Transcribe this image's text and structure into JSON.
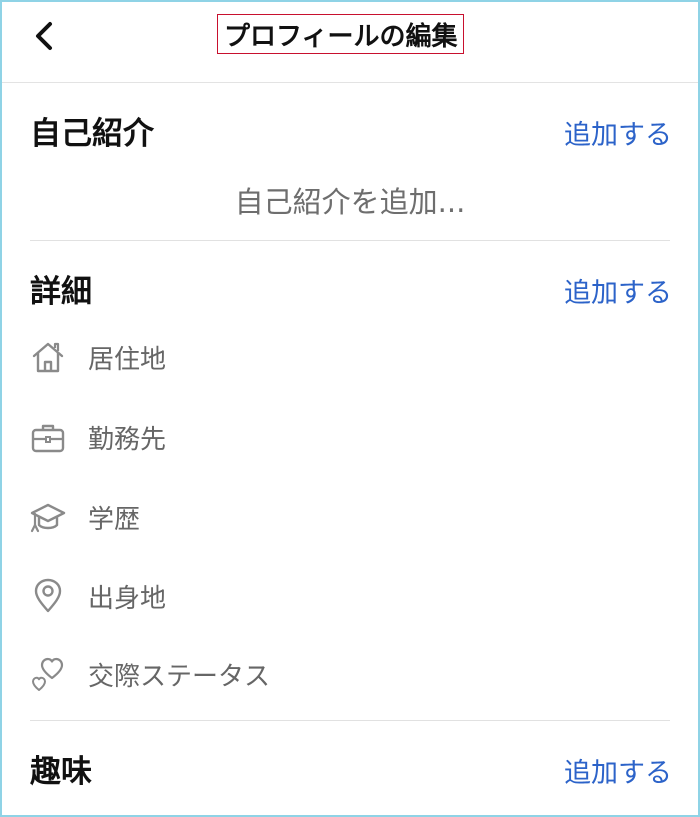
{
  "header": {
    "title": "プロフィールの編集",
    "back_icon": "chevron-left-icon"
  },
  "bio": {
    "title": "自己紹介",
    "add_label": "追加する",
    "placeholder": "自己紹介を追加..."
  },
  "details": {
    "title": "詳細",
    "add_label": "追加する",
    "items": [
      {
        "label": "居住地",
        "icon": "home-icon"
      },
      {
        "label": "勤務先",
        "icon": "briefcase-icon"
      },
      {
        "label": "学歴",
        "icon": "graduation-cap-icon"
      },
      {
        "label": "出身地",
        "icon": "location-pin-icon"
      },
      {
        "label": "交際ステータス",
        "icon": "hearts-icon"
      }
    ]
  },
  "hobbies": {
    "title": "趣味",
    "add_label": "追加する"
  },
  "colors": {
    "link": "#2c63c9",
    "icon": "#8a8a8a",
    "title_border": "#c8102e",
    "frame_border": "#8fd3e6"
  }
}
